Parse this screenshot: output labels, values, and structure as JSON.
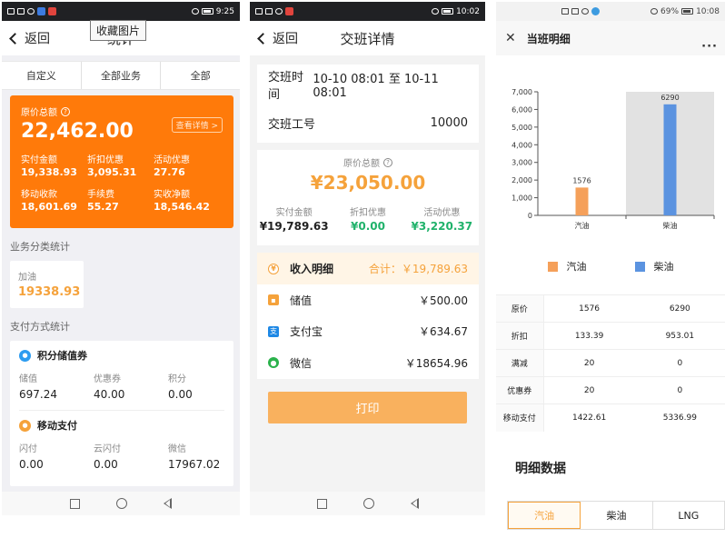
{
  "phone1": {
    "status_time": "9:25",
    "back_label": "返回",
    "title": "统计",
    "tooltip": "收藏图片",
    "filters": [
      "自定义",
      "全部业务",
      "全部"
    ],
    "summary": {
      "label": "原价总额",
      "total": "22,462.00",
      "detail_link": "查看详情 >",
      "items": [
        {
          "label": "实付金额",
          "value": "19,338.93"
        },
        {
          "label": "折扣优惠",
          "value": "3,095.31"
        },
        {
          "label": "活动优惠",
          "value": "27.76"
        },
        {
          "label": "移动收款",
          "value": "18,601.69"
        },
        {
          "label": "手续费",
          "value": "55.27"
        },
        {
          "label": "实收净额",
          "value": "18,546.42"
        }
      ]
    },
    "category_section": "业务分类统计",
    "category": {
      "label": "加油",
      "value": "19338.93"
    },
    "payment_section": "支付方式统计",
    "payment_groups": [
      {
        "title": "积分储值券",
        "items": [
          {
            "label": "储值",
            "value": "697.24"
          },
          {
            "label": "优惠券",
            "value": "40.00"
          },
          {
            "label": "积分",
            "value": "0.00"
          }
        ]
      },
      {
        "title": "移动支付",
        "items": [
          {
            "label": "闪付",
            "value": "0.00"
          },
          {
            "label": "云闪付",
            "value": "0.00"
          },
          {
            "label": "微信",
            "value": "17967.02"
          }
        ]
      }
    ]
  },
  "phone2": {
    "status_time": "10:02",
    "back_label": "返回",
    "title": "交班详情",
    "shift_time_label": "交班时间",
    "shift_time_value": "10-10 08:01 至 10-11 08:01",
    "shift_no_label": "交班工号",
    "shift_no_value": "10000",
    "total_label": "原价总额",
    "total_value": "¥23,050.00",
    "stats": [
      {
        "label": "实付金额",
        "value": "¥19,789.63",
        "color": "#222222"
      },
      {
        "label": "折扣优惠",
        "value": "¥0.00",
        "color": "#20b26b"
      },
      {
        "label": "活动优惠",
        "value": "¥3,220.37",
        "color": "#20b26b"
      }
    ],
    "income_title": "收入明细",
    "income_total": "合计：￥19,789.63",
    "income_rows": [
      {
        "name": "储值",
        "value": "￥500.00",
        "icon": "wallet-icon",
        "color": "#f5a23b"
      },
      {
        "name": "支付宝",
        "value": "￥634.67",
        "icon": "alipay-icon",
        "color": "#1e88e5"
      },
      {
        "name": "微信",
        "value": "￥18654.96",
        "icon": "wechat-icon",
        "color": "#2bb24c"
      }
    ],
    "print_label": "打印"
  },
  "phone3": {
    "status_time": "10:08",
    "status_battery": "69%",
    "title": "当班明细",
    "more": "···",
    "chart_data": {
      "type": "bar",
      "categories": [
        "汽油",
        "柴油"
      ],
      "values": [
        1576,
        6290
      ],
      "colors": [
        "#f5a05a",
        "#5b93e0"
      ],
      "ylim": [
        0,
        7000
      ],
      "yticks": [
        "0",
        "1,000",
        "2,000",
        "3,000",
        "4,000",
        "5,000",
        "6,000",
        "7,000"
      ],
      "highlighted_category": "柴油"
    },
    "legend": [
      {
        "name": "汽油",
        "color": "#f5a05a"
      },
      {
        "name": "柴油",
        "color": "#5b93e0"
      }
    ],
    "table": [
      {
        "label": "原价",
        "gas": "1576",
        "diesel": "6290"
      },
      {
        "label": "折扣",
        "gas": "133.39",
        "diesel": "953.01"
      },
      {
        "label": "满减",
        "gas": "20",
        "diesel": "0"
      },
      {
        "label": "优惠券",
        "gas": "20",
        "diesel": "0"
      },
      {
        "label": "移动支付",
        "gas": "1422.61",
        "diesel": "5336.99"
      }
    ],
    "detail_title": "明细数据",
    "tabs": [
      "汽油",
      "柴油",
      "LNG"
    ]
  }
}
